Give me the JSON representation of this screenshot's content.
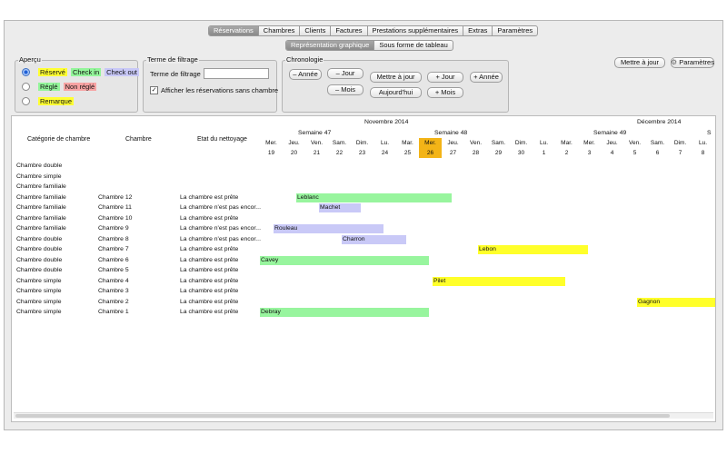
{
  "tabs": [
    {
      "label": "Réservations",
      "selected": true
    },
    {
      "label": "Chambres"
    },
    {
      "label": "Clients"
    },
    {
      "label": "Factures"
    },
    {
      "label": "Prestations supplémentaires"
    },
    {
      "label": "Extras"
    },
    {
      "label": "Paramètres"
    }
  ],
  "view_tabs": [
    {
      "label": "Représentation graphique",
      "selected": true
    },
    {
      "label": "Sous forme de tableau"
    }
  ],
  "apercu": {
    "title": "Aperçu",
    "rows": [
      {
        "badges": [
          {
            "text": "Réservé",
            "color": "#ffff33"
          },
          {
            "text": "Check in",
            "color": "#93f59a"
          },
          {
            "text": "Check out",
            "color": "#c8c8f7"
          }
        ]
      },
      {
        "badges": [
          {
            "text": "Réglé",
            "color": "#93f59a"
          },
          {
            "text": "Non réglé",
            "color": "#f7a3a3"
          }
        ]
      },
      {
        "badges": [
          {
            "text": "Remarque",
            "color": "#ffff33"
          }
        ]
      }
    ]
  },
  "filtrage": {
    "title": "Terme de filtrage",
    "label": "Terme de filtrage",
    "value": "",
    "checkbox_label": "Afficher les réservations sans chambre",
    "checked": true
  },
  "chronologie": {
    "title": "Chronologie",
    "prev_year": "– Année",
    "prev_day": "– Jour",
    "prev_month": "– Mois",
    "today_start": "Mettre à jour",
    "today": "Aujourd'hui",
    "next_day": "+ Jour",
    "next_month": "+ Mois",
    "next_year": "+ Année"
  },
  "toolbar": {
    "update": "Mettre à jour",
    "settings": "Paramètres"
  },
  "grid": {
    "headers": {
      "category": "Catégorie de chambre",
      "room": "Chambre",
      "cleaning": "Etat du nettoyage"
    },
    "months": [
      {
        "label": "Novembre 2014",
        "day_index": 5
      },
      {
        "label": "Décembre 2014",
        "day_index": 17
      }
    ],
    "weeks": [
      {
        "label": "Semaine 47",
        "day_index": 2
      },
      {
        "label": "Semaine 48",
        "day_index": 8
      },
      {
        "label": "Semaine 49",
        "day_index": 15
      },
      {
        "label": "S",
        "day_index": 20
      }
    ],
    "days": [
      {
        "wd": "Mer.",
        "d": "19"
      },
      {
        "wd": "Jeu.",
        "d": "20"
      },
      {
        "wd": "Ven.",
        "d": "21"
      },
      {
        "wd": "Sam.",
        "d": "22"
      },
      {
        "wd": "Dim.",
        "d": "23"
      },
      {
        "wd": "Lu.",
        "d": "24"
      },
      {
        "wd": "Mar.",
        "d": "25"
      },
      {
        "wd": "Mer.",
        "d": "26",
        "today": true
      },
      {
        "wd": "Jeu.",
        "d": "27"
      },
      {
        "wd": "Ven.",
        "d": "28"
      },
      {
        "wd": "Sam.",
        "d": "29"
      },
      {
        "wd": "Dim.",
        "d": "30"
      },
      {
        "wd": "Lu.",
        "d": "1"
      },
      {
        "wd": "Mar.",
        "d": "2"
      },
      {
        "wd": "Mer.",
        "d": "3"
      },
      {
        "wd": "Jeu.",
        "d": "4"
      },
      {
        "wd": "Ven.",
        "d": "5"
      },
      {
        "wd": "Sam.",
        "d": "6"
      },
      {
        "wd": "Dim.",
        "d": "7"
      },
      {
        "wd": "Lu.",
        "d": "8"
      }
    ],
    "rows": [
      {
        "category": "Chambre double",
        "room": "",
        "cleaning": ""
      },
      {
        "category": "Chambre simple",
        "room": "",
        "cleaning": ""
      },
      {
        "category": "Chambre familiale",
        "room": "",
        "cleaning": ""
      },
      {
        "category": "Chambre familiale",
        "room": "Chambre 12",
        "cleaning": "La chambre est prête"
      },
      {
        "category": "Chambre familiale",
        "room": "Chambre 11",
        "cleaning": "La chambre n'est pas encor..."
      },
      {
        "category": "Chambre familiale",
        "room": "Chambre 10",
        "cleaning": "La chambre est prête"
      },
      {
        "category": "Chambre familiale",
        "room": "Chambre 9",
        "cleaning": "La chambre n'est pas encor..."
      },
      {
        "category": "Chambre double",
        "room": "Chambre 8",
        "cleaning": "La chambre n'est pas encor..."
      },
      {
        "category": "Chambre double",
        "room": "Chambre 7",
        "cleaning": "La chambre est prête"
      },
      {
        "category": "Chambre double",
        "room": "Chambre 6",
        "cleaning": "La chambre est prête"
      },
      {
        "category": "Chambre double",
        "room": "Chambre 5",
        "cleaning": "La chambre est prête"
      },
      {
        "category": "Chambre simple",
        "room": "Chambre 4",
        "cleaning": "La chambre est prête"
      },
      {
        "category": "Chambre simple",
        "room": "Chambre 3",
        "cleaning": "La chambre est prête"
      },
      {
        "category": "Chambre simple",
        "room": "Chambre 2",
        "cleaning": "La chambre est prête"
      },
      {
        "category": "Chambre simple",
        "room": "Chambre 1",
        "cleaning": "La chambre est prête"
      }
    ],
    "bookings": [
      {
        "name": "Leblanc",
        "row": 3,
        "start": 1.6,
        "end": 8.4,
        "color": "#98f59e"
      },
      {
        "name": "Machet",
        "row": 4,
        "start": 2.6,
        "end": 4.4,
        "color": "#c9c9f7"
      },
      {
        "name": "Rouleau",
        "row": 6,
        "start": 0.6,
        "end": 5.4,
        "color": "#c9c9f7"
      },
      {
        "name": "Charron",
        "row": 7,
        "start": 3.6,
        "end": 6.4,
        "color": "#c9c9f7"
      },
      {
        "name": "Lebon",
        "row": 8,
        "start": 9.6,
        "end": 14.4,
        "color": "#ffff2a"
      },
      {
        "name": "Cavey",
        "row": 9,
        "start": 0,
        "end": 7.4,
        "color": "#98f59e"
      },
      {
        "name": "Pilet",
        "row": 11,
        "start": 7.6,
        "end": 13.4,
        "color": "#ffff2a"
      },
      {
        "name": "Gagnon",
        "row": 13,
        "start": 16.6,
        "end": 20,
        "color": "#ffff2a"
      },
      {
        "name": "Debray",
        "row": 14,
        "start": 0,
        "end": 7.4,
        "color": "#98f59e"
      }
    ]
  }
}
